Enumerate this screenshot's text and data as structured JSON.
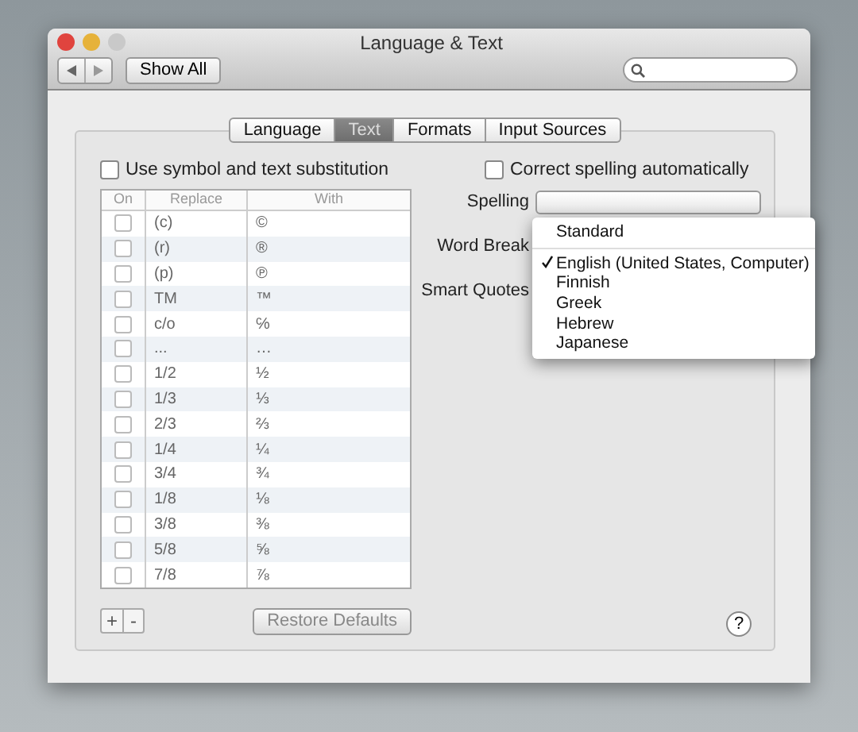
{
  "window": {
    "title": "Language & Text"
  },
  "toolbar": {
    "show_all": "Show All"
  },
  "tabs": [
    {
      "label": "Language",
      "selected": false
    },
    {
      "label": "Text",
      "selected": true
    },
    {
      "label": "Formats",
      "selected": false
    },
    {
      "label": "Input Sources",
      "selected": false
    }
  ],
  "substitution": {
    "label": "Use symbol and text substitution",
    "checked": false
  },
  "table": {
    "columns": [
      "On",
      "Replace",
      "With"
    ],
    "rows": [
      {
        "on": false,
        "replace": "(c)",
        "with": "©"
      },
      {
        "on": false,
        "replace": "(r)",
        "with": "®"
      },
      {
        "on": false,
        "replace": "(p)",
        "with": "℗"
      },
      {
        "on": false,
        "replace": "TM",
        "with": "™"
      },
      {
        "on": false,
        "replace": "c/o",
        "with": "℅"
      },
      {
        "on": false,
        "replace": "...",
        "with": "…"
      },
      {
        "on": false,
        "replace": "1/2",
        "with": "½"
      },
      {
        "on": false,
        "replace": "1/3",
        "with": "⅓"
      },
      {
        "on": false,
        "replace": "2/3",
        "with": "⅔"
      },
      {
        "on": false,
        "replace": "1/4",
        "with": "¼"
      },
      {
        "on": false,
        "replace": "3/4",
        "with": "¾"
      },
      {
        "on": false,
        "replace": "1/8",
        "with": "⅛"
      },
      {
        "on": false,
        "replace": "3/8",
        "with": "⅜"
      },
      {
        "on": false,
        "replace": "5/8",
        "with": "⅝"
      },
      {
        "on": false,
        "replace": "7/8",
        "with": "⅞"
      }
    ]
  },
  "table_buttons": {
    "add": "+",
    "remove": "-",
    "restore": "Restore Defaults"
  },
  "correct_spelling": {
    "label": "Correct spelling automatically",
    "checked": false
  },
  "settings": [
    "Spelling",
    "Word Break",
    "Smart Quotes"
  ],
  "menu": [
    {
      "kind": "item",
      "label": "Standard",
      "checked": false
    },
    {
      "kind": "separator"
    },
    {
      "kind": "item",
      "label": "English (United States, Computer)",
      "checked": true
    },
    {
      "kind": "item",
      "label": "Finnish",
      "checked": false
    },
    {
      "kind": "item",
      "label": "Greek",
      "checked": false
    },
    {
      "kind": "item",
      "label": "Hebrew",
      "checked": false
    },
    {
      "kind": "item",
      "label": "Japanese",
      "checked": false
    }
  ],
  "help": "?"
}
